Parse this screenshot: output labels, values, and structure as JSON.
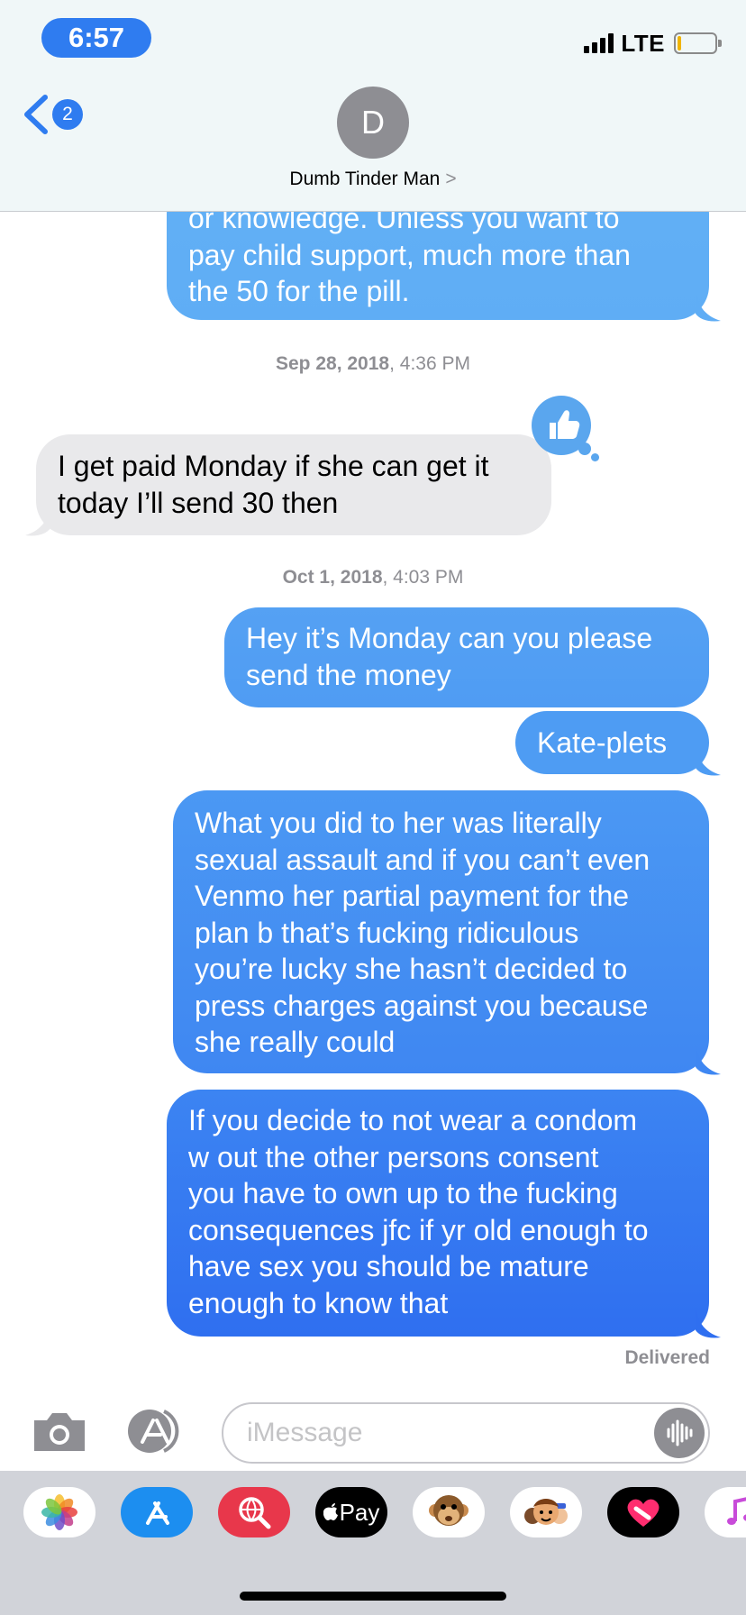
{
  "status_bar": {
    "time": "6:57",
    "network": "LTE"
  },
  "nav": {
    "back_count": "2",
    "avatar_initial": "D",
    "contact_name": "Dumb Tinder Man",
    "contact_chevron": ">"
  },
  "colors": {
    "accent": "#2f7cf0",
    "sent_top": "#64b2f5",
    "sent_bottom": "#2f6ef0",
    "received": "#e9e9eb",
    "timestamp": "#8e8e93"
  },
  "messages": [
    {
      "type": "sent",
      "lines": [
        "or knowledge. Unless you want to",
        "pay child support, much more than",
        "the 50 for the pill."
      ]
    },
    {
      "type": "timestamp",
      "date": "Sep 28, 2018",
      "time": "4:36 PM"
    },
    {
      "type": "received",
      "lines": [
        "I get paid Monday if she can get it",
        "today I’ll send 30 then"
      ],
      "tapback": "thumbs-up"
    },
    {
      "type": "timestamp",
      "date": "Oct 1, 2018",
      "time": "4:03 PM"
    },
    {
      "type": "sent",
      "lines": [
        "Hey it’s Monday can you please",
        "send the money"
      ]
    },
    {
      "type": "sent",
      "lines": [
        "Kate-plets"
      ]
    },
    {
      "type": "sent",
      "lines": [
        "What you did to her was literally",
        "sexual assault and if you can’t even",
        "Venmo her partial payment for the",
        "plan b that’s fucking ridiculous",
        "you’re lucky she hasn’t decided to",
        "press charges against you because",
        "she really could"
      ]
    },
    {
      "type": "sent",
      "lines": [
        "If you decide to not wear a condom",
        "w out the other persons consent",
        "you have to own up to the fucking",
        "consequences jfc if yr old enough to",
        "have sex you should be mature",
        "enough to know that"
      ]
    }
  ],
  "delivery_status": "Delivered",
  "composer": {
    "placeholder": "iMessage"
  },
  "app_drawer": [
    {
      "name": "photos-app",
      "icon": "photos-icon"
    },
    {
      "name": "app-store-app",
      "icon": "app-store-icon"
    },
    {
      "name": "images-search-app",
      "icon": "globe-search-icon"
    },
    {
      "name": "apple-pay-app",
      "icon": "apple-pay-icon",
      "label": "Pay"
    },
    {
      "name": "animoji-app",
      "icon": "monkey-icon"
    },
    {
      "name": "memoji-stickers-app",
      "icon": "memoji-icon"
    },
    {
      "name": "digital-touch-app",
      "icon": "heart-icon"
    },
    {
      "name": "music-app",
      "icon": "music-icon"
    }
  ]
}
